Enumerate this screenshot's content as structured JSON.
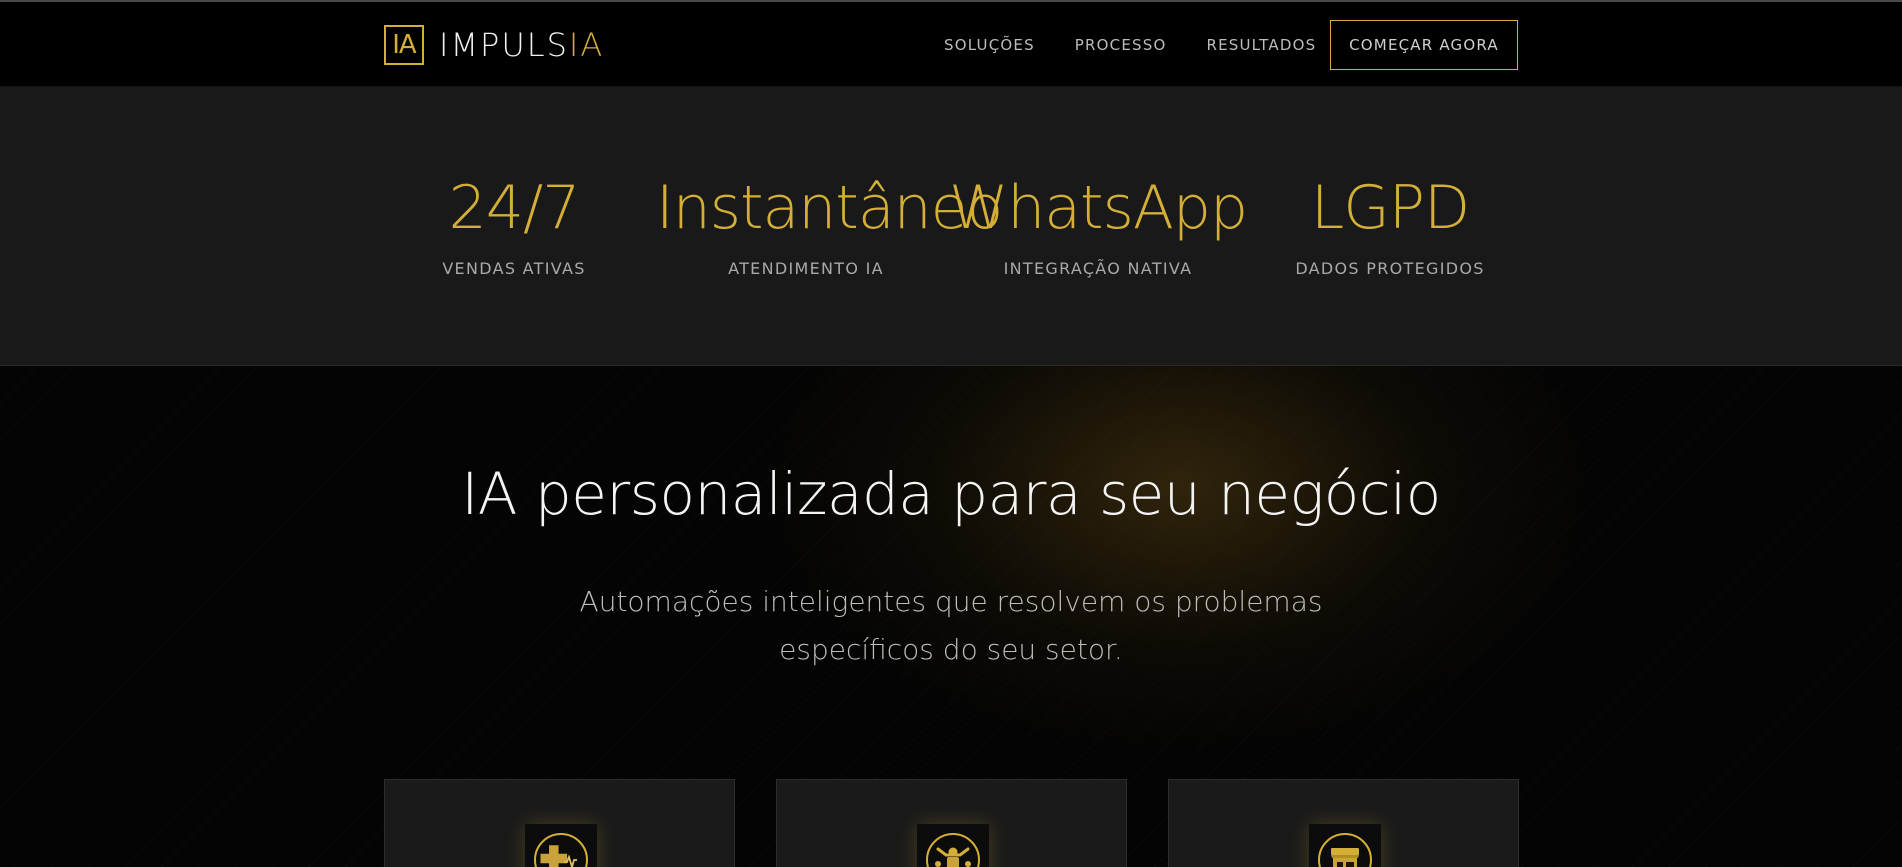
{
  "header": {
    "logo_mark": "IA",
    "logo_text_main": "IMPULS",
    "logo_text_accent": "IA",
    "nav": [
      {
        "label": "SOLUÇÕES"
      },
      {
        "label": "PROCESSO"
      },
      {
        "label": "RESULTADOS"
      }
    ],
    "cta_label": "COMEÇAR AGORA"
  },
  "stats": [
    {
      "value": "24/7",
      "label": "VENDAS ATIVAS"
    },
    {
      "value": "Instantâneo",
      "label": "ATENDIMENTO IA"
    },
    {
      "value": "WhatsApp",
      "label": "INTEGRAÇÃO NATIVA"
    },
    {
      "value": "LGPD",
      "label": "DADOS PROTEGIDOS"
    }
  ],
  "hero": {
    "title": "IA personalizada para seu negócio",
    "subtitle": "Automações inteligentes que resolvem os problemas específicos do seu setor."
  },
  "cards": [
    {
      "icon": "health-cross-heartbeat-icon"
    },
    {
      "icon": "fitness-weightlifter-icon"
    },
    {
      "icon": "store-shopfront-icon"
    }
  ],
  "colors": {
    "accent": "#d4af37",
    "background": "#000000",
    "stats_band": "#191919",
    "card": "#1a1a1a"
  }
}
